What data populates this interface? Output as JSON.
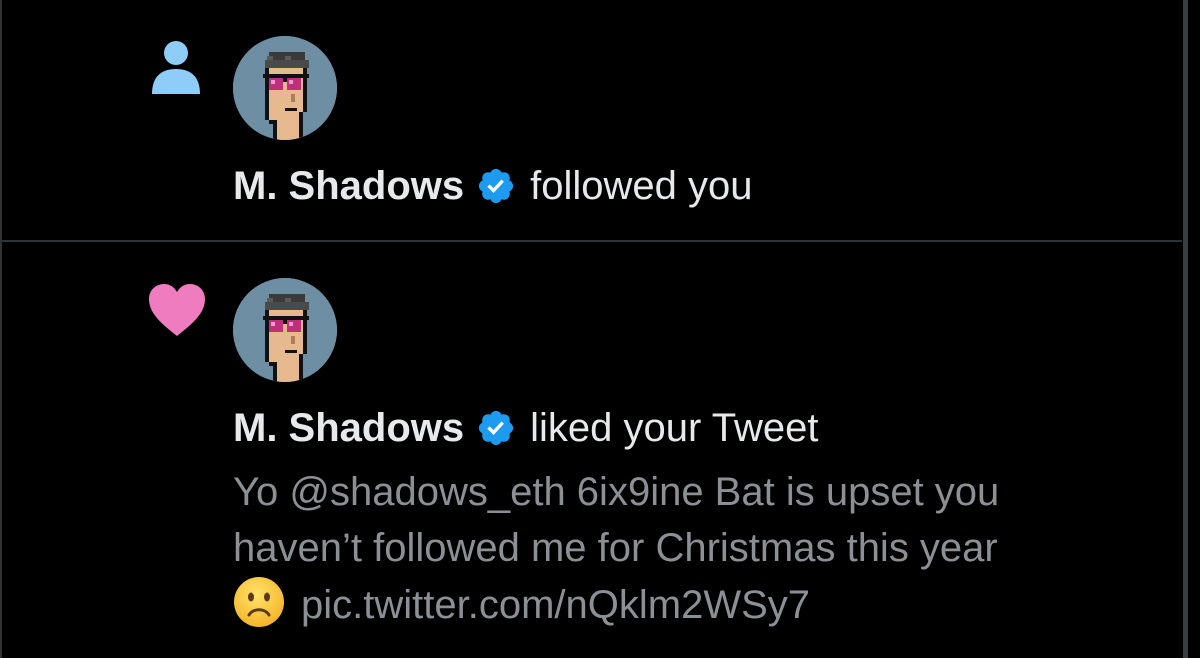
{
  "notifications": [
    {
      "type": "follow",
      "icon": "person-icon",
      "icon_color": "#8ecdf8",
      "actor": "M. Shadows",
      "verified": true,
      "action": "followed you"
    },
    {
      "type": "like",
      "icon": "heart-icon",
      "icon_color": "#f07cc0",
      "actor": "M. Shadows",
      "verified": true,
      "action": "liked your Tweet",
      "tweet_lines": [
        "Yo @shadows_eth 6ix9ine Bat is upset you",
        "haven’t followed me for Christmas this year",
        "pic.twitter.com/nQklm2WSy7"
      ],
      "tweet_emoji": "frowning-face-emoji"
    }
  ],
  "colors": {
    "background": "#000000",
    "primary_text": "#e7e9ea",
    "secondary_text": "#8b9096",
    "verified_badge": "#1d9bf0",
    "divider": "#2f3336"
  }
}
